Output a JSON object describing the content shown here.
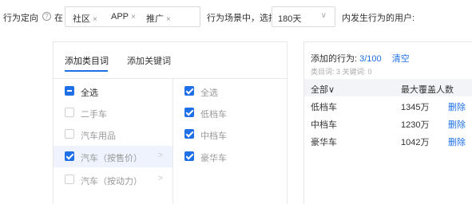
{
  "targeting": {
    "label": "行为定向",
    "help_glyph": "?",
    "in_label": "在",
    "tags": [
      {
        "label": "社区",
        "remove": "×"
      },
      {
        "label": "APP",
        "remove": "×"
      },
      {
        "label": "推广",
        "remove": "×"
      }
    ],
    "scene_label": "行为场景中，选择",
    "period_value": "180天",
    "period_chevron": "∨",
    "suffix_label": "内发生行为的用户:"
  },
  "tabs": [
    {
      "label": "添加类目词",
      "active": true
    },
    {
      "label": "添加关键词",
      "active": false
    }
  ],
  "categories_level1": [
    {
      "label": "全选",
      "state": "indeterminate",
      "highlighted": false
    },
    {
      "label": "二手车",
      "state": "unchecked",
      "highlighted": false
    },
    {
      "label": "汽车用品",
      "state": "unchecked",
      "highlighted": false
    },
    {
      "label": "汽车（按售价）",
      "state": "checked",
      "highlighted": true,
      "arrow": ">"
    },
    {
      "label": "汽车（按动力）",
      "state": "unchecked",
      "highlighted": false,
      "arrow": ">"
    }
  ],
  "categories_level2": [
    {
      "label": "全选",
      "state": "checked"
    },
    {
      "label": "低档车",
      "state": "checked"
    },
    {
      "label": "中档车",
      "state": "checked"
    },
    {
      "label": "豪华车",
      "state": "checked"
    }
  ],
  "selected_panel": {
    "title_prefix": "添加的行为:",
    "count": "3/100",
    "clear_label": "清空",
    "sub": "类目词: 3   关键词: 0",
    "col_all": "全部∨",
    "col_reach": "最大覆盖人数",
    "rows": [
      {
        "name": "低档车",
        "reach": "1345万",
        "action": "删除"
      },
      {
        "name": "中档车",
        "reach": "1230万",
        "action": "删除"
      },
      {
        "name": "豪华车",
        "reach": "1042万",
        "action": "删除"
      }
    ]
  },
  "colors": {
    "accent": "#1f6fe6",
    "highlight": "#eef3fd",
    "border": "#e8e8e8"
  }
}
